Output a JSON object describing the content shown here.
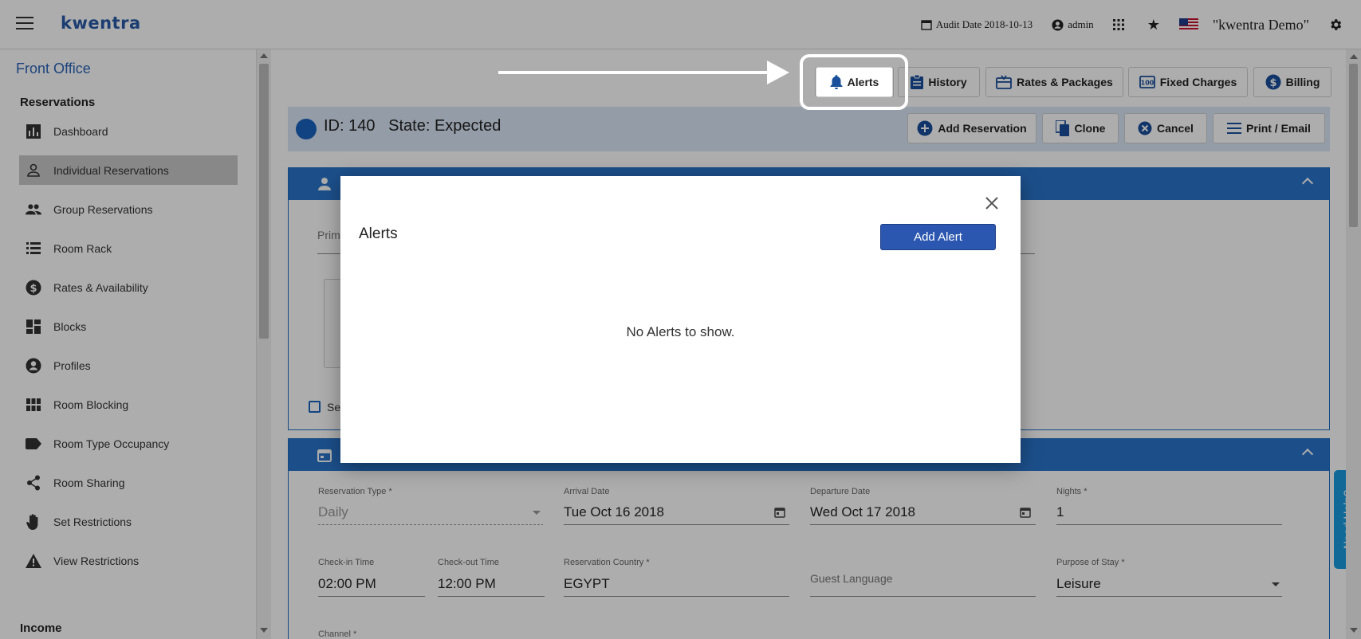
{
  "topbar": {
    "logo": "kwentra",
    "audit_date": "Audit Date 2018-10-13",
    "user": "admin",
    "property": "\"kwentra Demo\""
  },
  "sidebar": {
    "title": "Front Office",
    "section": "Reservations",
    "items": [
      {
        "label": "Dashboard",
        "icon": "bar-chart-icon"
      },
      {
        "label": "Individual Reservations",
        "icon": "person-icon",
        "active": true
      },
      {
        "label": "Group Reservations",
        "icon": "group-icon"
      },
      {
        "label": "Room Rack",
        "icon": "list-icon"
      },
      {
        "label": "Rates & Availability",
        "icon": "dollar-icon"
      },
      {
        "label": "Blocks",
        "icon": "dashboard-icon"
      },
      {
        "label": "Profiles",
        "icon": "account-circle-icon"
      },
      {
        "label": "Room Blocking",
        "icon": "grid-icon"
      },
      {
        "label": "Room Type Occupancy",
        "icon": "label-icon"
      },
      {
        "label": "Room Sharing",
        "icon": "share-icon"
      },
      {
        "label": "Set Restrictions",
        "icon": "hand-icon"
      },
      {
        "label": "View Restrictions",
        "icon": "warning-icon"
      }
    ],
    "bottom_section": "Income"
  },
  "toolbar": {
    "alerts": "Alerts",
    "history": "History",
    "rates_packages": "Rates & Packages",
    "fixed_charges": "Fixed Charges",
    "billing": "Billing"
  },
  "reservation": {
    "id_text": "ID: 140",
    "state_text": "State: Expected",
    "add_reservation": "Add Reservation",
    "clone": "Clone",
    "cancel": "Cancel",
    "print_email": "Print / Email"
  },
  "guest_panel": {
    "primary_placeholder": "Prim",
    "checkbox_label": "Se"
  },
  "stay_panel": {
    "reservation_type_label": "Reservation Type *",
    "reservation_type_value": "Daily",
    "arrival_label": "Arrival Date",
    "arrival_value": "Tue Oct 16 2018",
    "departure_label": "Departure Date",
    "departure_value": "Wed Oct 17 2018",
    "nights_label": "Nights *",
    "nights_value": "1",
    "checkin_label": "Check-in Time",
    "checkin_value": "02:00 PM",
    "checkout_label": "Check-out Time",
    "checkout_value": "12:00 PM",
    "country_label": "Reservation Country *",
    "country_value": "EGYPT",
    "guest_language_placeholder": "Guest Language",
    "purpose_label": "Purpose of Stay *",
    "purpose_value": "Leisure",
    "channel_label": "Channel *"
  },
  "help": "Need Help?",
  "modal": {
    "title": "Alerts",
    "add_button": "Add Alert",
    "empty_text": "No Alerts to show."
  }
}
